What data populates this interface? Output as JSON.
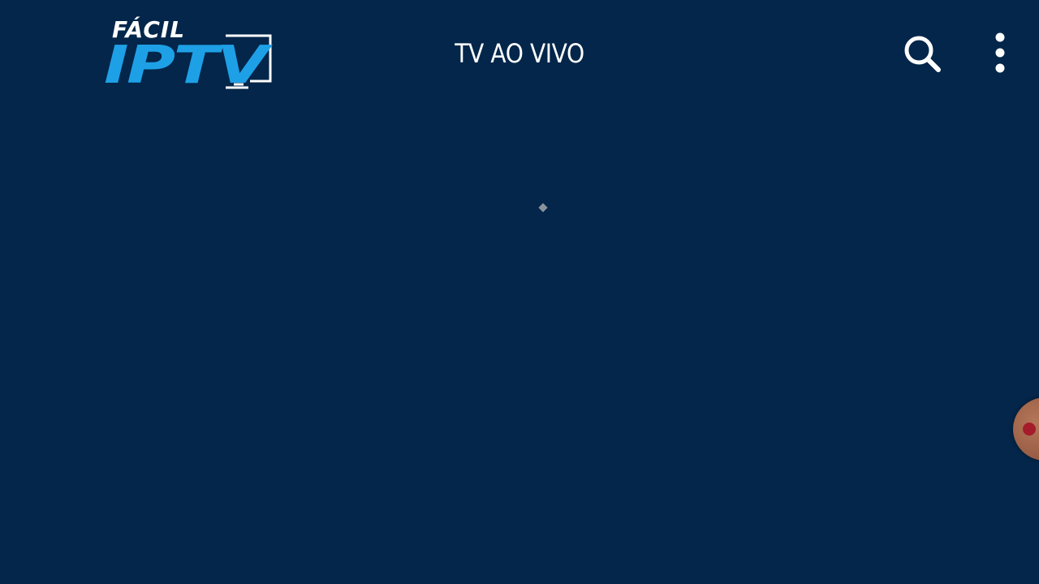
{
  "app": {
    "logo_text_top": "FÁCIL",
    "logo_text_main": "IPTV",
    "title": "TV AO VIVO"
  },
  "colors": {
    "background": "#03264a",
    "logo_blue": "#1ea0e6",
    "white": "#ffffff"
  },
  "toolbar": {
    "search_icon": "search-icon",
    "menu_icon": "more-vertical-icon"
  },
  "floating": {
    "icon": "screen-record-icon"
  }
}
